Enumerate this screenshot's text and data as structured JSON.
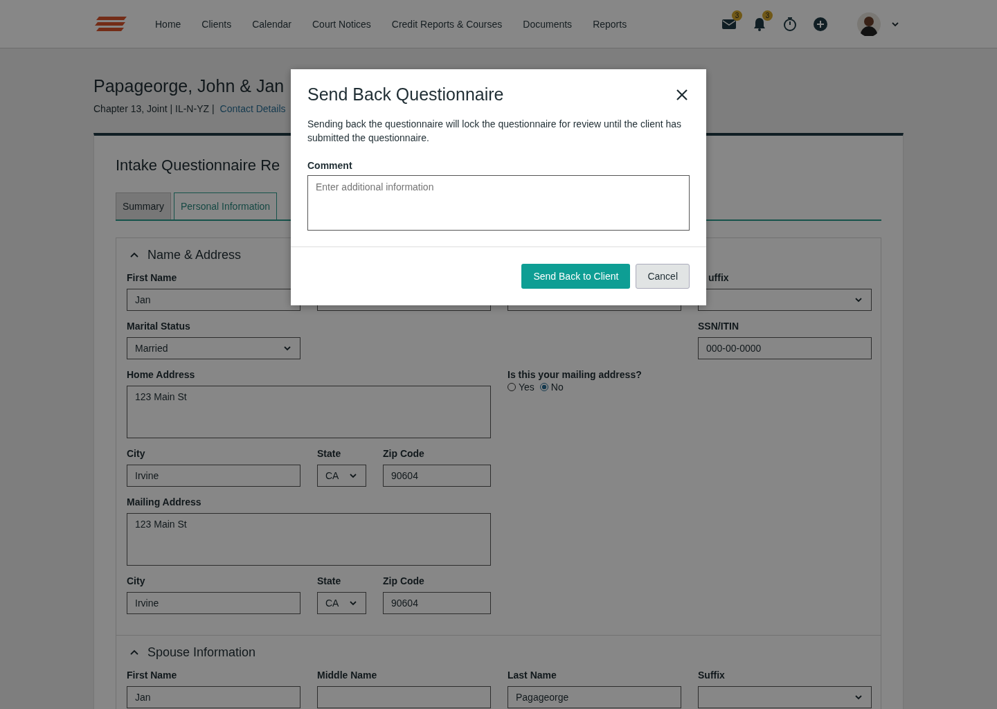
{
  "nav": {
    "links": [
      "Home",
      "Clients",
      "Calendar",
      "Court Notices",
      "Credit Reports & Courses",
      "Documents",
      "Reports"
    ],
    "icons": [
      {
        "kind": "mail",
        "badge": "3"
      },
      {
        "kind": "bell",
        "badge": "3"
      },
      {
        "kind": "timer"
      },
      {
        "kind": "add"
      }
    ]
  },
  "client": {
    "name": "Papageorge, John & Jan",
    "details": "Chapter 13, Joint | IL-N-YZ |",
    "link": "Contact Details"
  },
  "questionnaire": {
    "title": "Intake Questionnaire Re",
    "tabs": [
      {
        "label": "Summary",
        "selected": false
      },
      {
        "label": "Personal Information",
        "selected": true
      }
    ],
    "sections": [
      {
        "title": "Name & Address",
        "expanded": true,
        "rows": [
          [
            {
              "kind": "text",
              "label": "First Name",
              "value": "Jan"
            },
            {
              "kind": "text"
            },
            {
              "kind": "text"
            },
            {
              "kind": "select",
              "label": "uffix"
            }
          ],
          [
            {
              "kind": "select",
              "label": "Marital Status",
              "value": "Married"
            },
            null,
            null,
            {
              "kind": "text",
              "label": "SSN/ITIN",
              "value": "000-00-0000"
            }
          ],
          [
            {
              "kind": "textarea",
              "label": "Home Address",
              "value": "123 Main St"
            },
            {
              "kind": "radio",
              "label": "Is this your mailing address?",
              "options": [
                {
                  "label": "Yes",
                  "selected": false
                },
                {
                  "label": "No",
                  "selected": true
                }
              ]
            }
          ],
          [
            {
              "kind": "text",
              "label": "City",
              "value": "Irvine"
            },
            [
              {
                "kind": "select",
                "label": "State",
                "value": "CA"
              },
              {
                "kind": "text",
                "label": "Zip Code",
                "value": "90604"
              }
            ]
          ],
          [
            {
              "kind": "textarea",
              "label": "Mailing Address",
              "value": "123 Main St"
            }
          ],
          [
            {
              "kind": "text",
              "label": "City",
              "value": "Irvine"
            },
            [
              {
                "kind": "select",
                "label": "State",
                "value": "CA"
              },
              {
                "kind": "text",
                "label": "Zip Code",
                "value": "90604"
              }
            ]
          ]
        ]
      },
      {
        "title": "Spouse Information",
        "expanded": true,
        "rows": [
          [
            {
              "kind": "text",
              "label": "First Name",
              "value": "Jan"
            },
            {
              "kind": "text",
              "label": "Middle Name"
            },
            {
              "kind": "text",
              "label": "Last Name",
              "value": "Pagageorge"
            },
            {
              "kind": "select",
              "label": "Suffix"
            }
          ]
        ]
      }
    ]
  },
  "dialog": {
    "title": "Send Back Questionnaire",
    "message": "Sending back the questionnaire will lock the questionnaire for review until the client has submitted the questionnaire.",
    "comment_label": "Comment",
    "comment_placeholder": "Enter additional information",
    "buttons": [
      {
        "label": "Send Back to Client",
        "kind": "primary"
      },
      {
        "label": "Cancel",
        "kind": "secondary"
      }
    ]
  }
}
